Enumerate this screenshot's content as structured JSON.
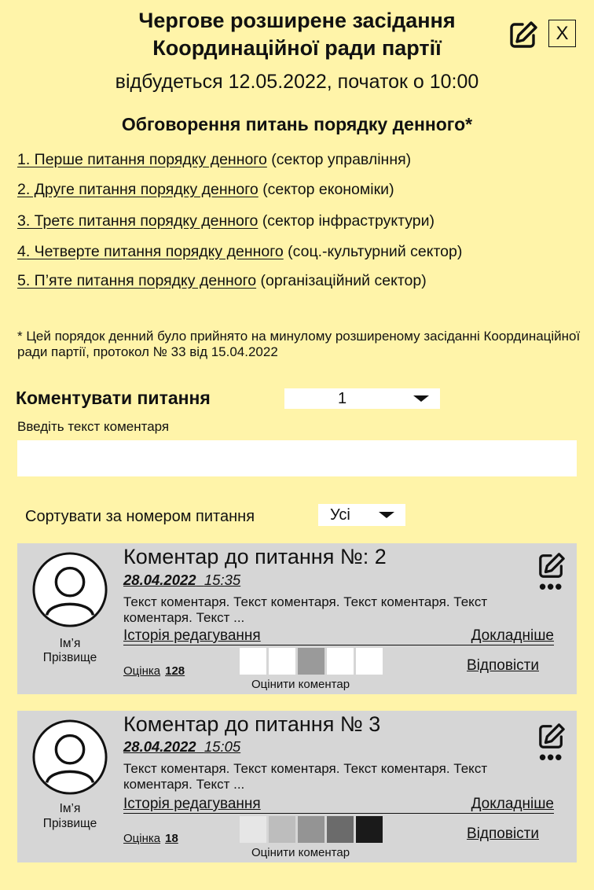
{
  "header": {
    "title_line1": "Чергове розширене засідання",
    "title_line2": "Координаційної ради партії",
    "close_label": "X",
    "subtitle": "відбудеться 12.05.2022, початок  о 10:00"
  },
  "agenda": {
    "title": "Обговорення питань порядку денного*",
    "items": [
      {
        "link": "1. Перше питання порядку денного",
        "sector": "(сектор управління)"
      },
      {
        "link": "2. Друге питання порядку денного",
        "sector": "(сектор економіки)"
      },
      {
        "link": "3. Третє питання порядку денного",
        "sector": "(сектор інфраструктури)"
      },
      {
        "link": "4. Четверте питання порядку денного",
        "sector": "(соц.-культурний сектор)"
      },
      {
        "link": "5. П’яте питання порядку денного",
        "sector": "(організаційний сектор)"
      }
    ],
    "note": "* Цей порядок денний було прийнято на минулому розширеному засіданні Координаційної ради партії, протокол № 33 від 15.04.2022"
  },
  "comment_form": {
    "label": "Коментувати питання",
    "selected_item": "1",
    "input_label": "Введіть текст коментаря",
    "input_value": ""
  },
  "sort": {
    "label": "Сортувати за номером питання",
    "selected": "Усі"
  },
  "comments": [
    {
      "title": "Коментар до питання №: 2",
      "date": "28.04.2022",
      "time": "15:35",
      "text": "Текст коментаря. Текст коментаря. Текст коментаря. Текст коментаря. Текст ...",
      "author_first": "Ім’я",
      "author_last": "Прізвище",
      "history": "Історія редагування",
      "details": "Докладніше",
      "rating_label": "Оцінка",
      "rating_value": "128",
      "reply": "Відповісти",
      "rate_caption": "Оцінити коментар",
      "rate_colors": [
        "#ffffff",
        "#ffffff",
        "#9a9a9a",
        "#ffffff",
        "#ffffff"
      ]
    },
    {
      "title": "Коментар до питання № 3",
      "date": "28.04.2022",
      "time": "15:05",
      "text": "Текст коментаря. Текст коментаря. Текст коментаря. Текст коментаря. Текст ...",
      "author_first": "Ім’я",
      "author_last": "Прізвище",
      "history": "Історія редагування",
      "details": "Докладніше",
      "rating_label": "Оцінка",
      "rating_value": "18",
      "reply": "Відповісти",
      "rate_caption": "Оцінити коментар",
      "rate_colors": [
        "#e6e6e6",
        "#bdbdbd",
        "#949494",
        "#6b6b6b",
        "#1a1a1a"
      ]
    }
  ],
  "icons": {
    "edit": "pencil-square-icon",
    "close": "close-icon",
    "more": "more-dots-icon",
    "avatar": "user-avatar-icon",
    "dropdown": "caret-down-icon"
  }
}
